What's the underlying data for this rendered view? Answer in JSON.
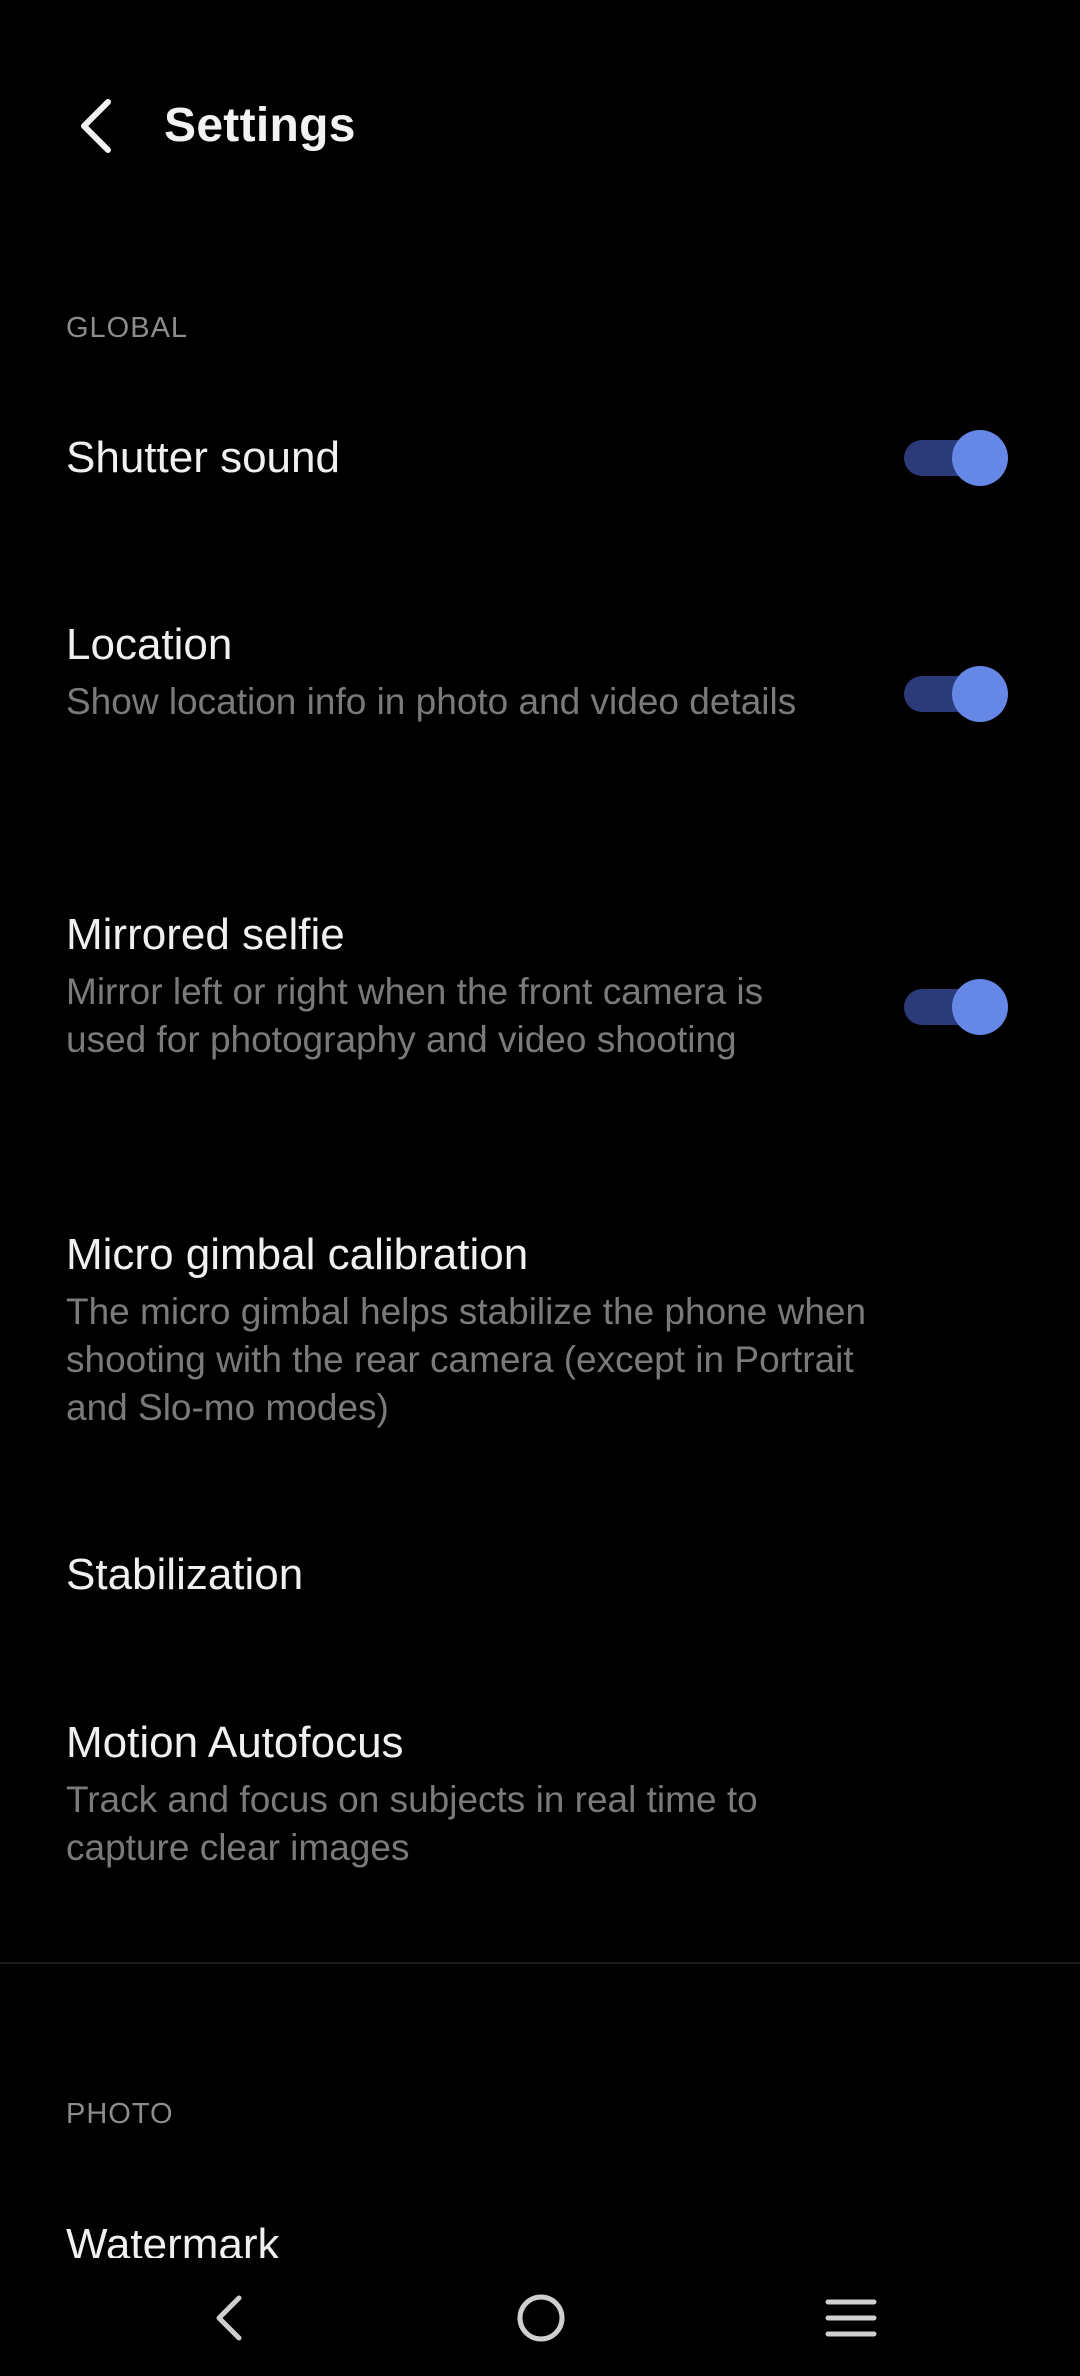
{
  "header": {
    "title": "Settings",
    "back_icon": "chevron-left-icon"
  },
  "sections": {
    "global_label": "GLOBAL",
    "photo_label": "PHOTO"
  },
  "settings": {
    "shutter_sound": {
      "title": "Shutter sound",
      "enabled": true
    },
    "location": {
      "title": "Location",
      "subtitle": "Show location info in photo and video details",
      "enabled": true
    },
    "mirrored_selfie": {
      "title": "Mirrored selfie",
      "subtitle": "Mirror left or right when the front camera is used for photography and video shooting",
      "enabled": true
    },
    "micro_gimbal": {
      "title": "Micro gimbal calibration",
      "subtitle": "The micro gimbal helps stabilize the phone when shooting with the rear camera (except in Portrait and Slo-mo modes)"
    },
    "stabilization": {
      "title": "Stabilization"
    },
    "motion_autofocus": {
      "title": "Motion Autofocus",
      "subtitle": "Track and focus on subjects in real time to capture clear images"
    },
    "watermark": {
      "title": "Watermark"
    }
  },
  "colors": {
    "background": "#000000",
    "toggle_track_on": "#2b3a78",
    "toggle_knob_on": "#6587e6",
    "subtitle_text": "#7a7a7a",
    "section_label": "#8c8c8c"
  },
  "nav": {
    "back_icon": "triangle-back-icon",
    "home_icon": "circle-home-icon",
    "menu_icon": "hamburger-menu-icon"
  }
}
